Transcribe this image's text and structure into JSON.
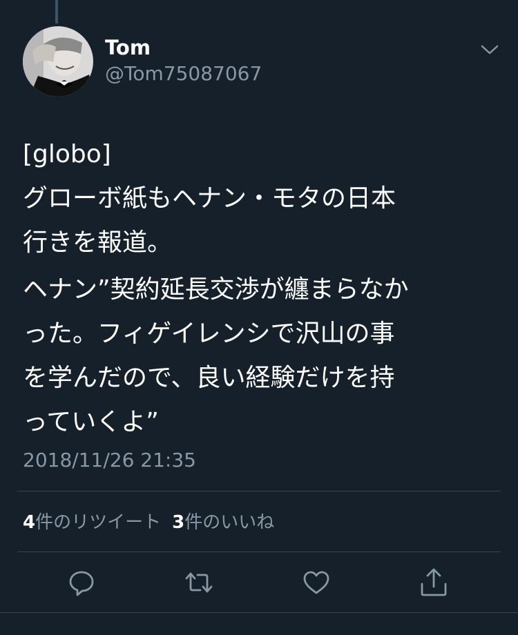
{
  "author": {
    "name": "Tom",
    "handle": "@Tom75087067"
  },
  "tweet": {
    "lines": [
      "[globo]",
      "グローボ紙もヘナン・モタの日本",
      "行きを報道。",
      "ヘナン”契約延長交渉が纏まらなか",
      "った。フィゲイレンシで沢山の事",
      "を学んだので、良い経験だけを持",
      "っていくよ”"
    ],
    "timestamp": "2018/11/26 21:35"
  },
  "stats": {
    "retweets_count": "4",
    "retweets_label": "件のリツイート",
    "likes_count": "3",
    "likes_label": "件のいいね"
  },
  "actions": {
    "reply_icon": "comment-icon",
    "retweet_icon": "retweet-icon",
    "like_icon": "heart-icon",
    "share_icon": "share-icon"
  },
  "colors": {
    "background": "#15202b",
    "secondary_text": "#8899a6",
    "divider": "#38444d"
  }
}
